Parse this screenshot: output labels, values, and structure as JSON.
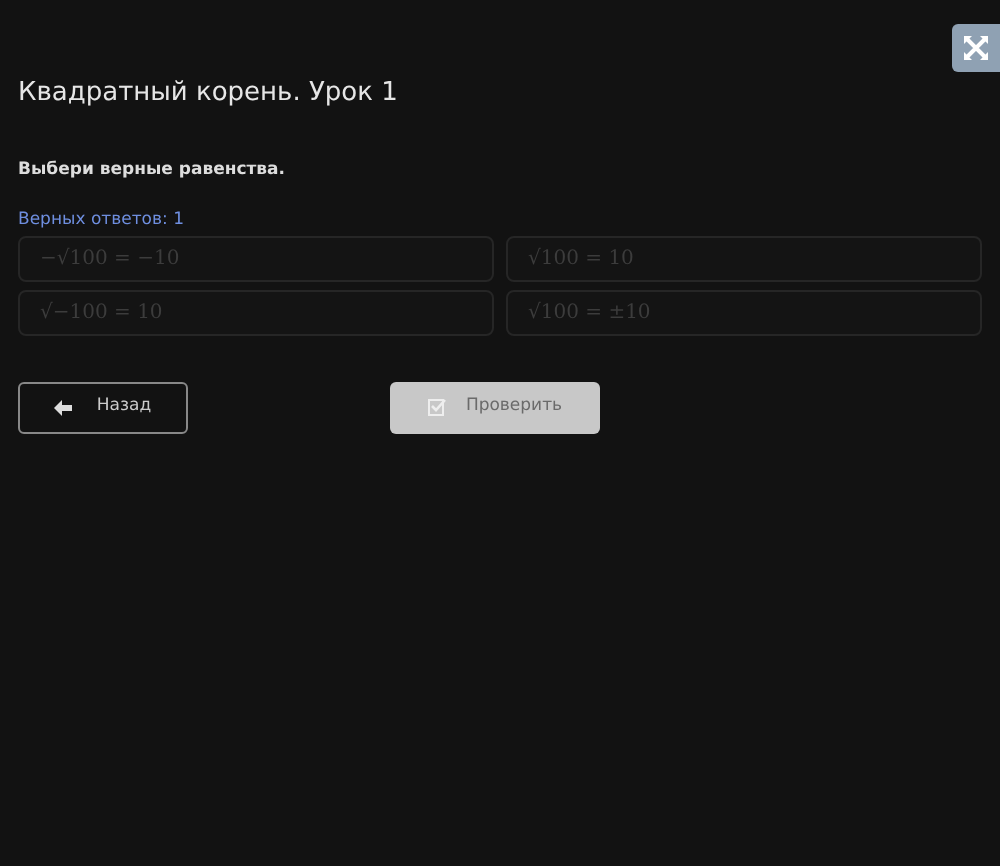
{
  "title": "Квадратный корень. Урок 1",
  "question": "Выбери верные равенства.",
  "answers_count": "Верных ответов: 1",
  "options": [
    {
      "text": "−√100 = −10",
      "selected": false
    },
    {
      "text": "√100 = 10",
      "selected": false
    },
    {
      "text": "√−100 = 10",
      "selected": false
    },
    {
      "text": "√100 = ±10",
      "selected": false
    }
  ],
  "back_button": {
    "label": "Назад"
  },
  "check_button": {
    "label": "Проверить",
    "disabled": true
  }
}
